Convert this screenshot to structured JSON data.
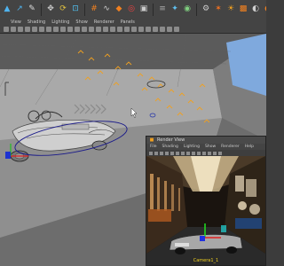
{
  "shelf": {
    "icons": [
      "select-tool-icon",
      "lasso-tool-icon",
      "paint-select-icon",
      "move-tool-icon",
      "rotate-tool-icon",
      "scale-tool-icon",
      "snap-grid-icon",
      "snap-curve-icon",
      "snap-point-icon",
      "snap-view-icon",
      "snap-surface-icon",
      "history-icon",
      "render-icon",
      "ipr-render-icon",
      "render-settings-icon",
      "hypershade-icon",
      "light-icon",
      "camera-icon",
      "material-icon",
      "sphere-icon",
      "cube-icon",
      "cylinder-icon",
      "shaded-ball-icon",
      "texture-icon",
      "uv-icon",
      "paint-icon",
      "sculpt-icon"
    ]
  },
  "viewport_menu": [
    "View",
    "Shading",
    "Lighting",
    "Show",
    "Renderer",
    "Panels"
  ],
  "render_view": {
    "title": "Render View",
    "menu": [
      "File",
      "Shading",
      "Lighting",
      "Show",
      "Renderer",
      "Help"
    ],
    "camera_label": "Camera1_1"
  },
  "colors": {
    "accent": "#f0a020",
    "panel": "#444444",
    "background": "#3c3c3c"
  }
}
